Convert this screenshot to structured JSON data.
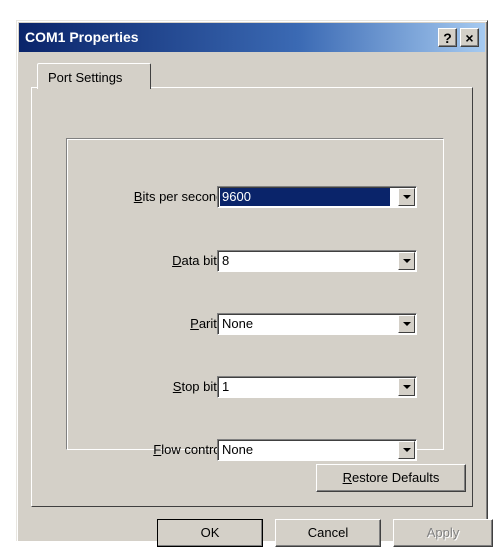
{
  "window": {
    "title": "COM1 Properties",
    "help_label": "?",
    "close_label": "×"
  },
  "tabs": [
    {
      "label": "Port Settings",
      "active": true
    }
  ],
  "fields": {
    "bits_per_second": {
      "label_accel": "B",
      "label_rest": "its per second:",
      "value": "9600"
    },
    "data_bits": {
      "label_pre": "",
      "label_accel": "D",
      "label_rest": "ata bits:",
      "value": "8"
    },
    "parity": {
      "label_accel": "P",
      "label_rest": "arity:",
      "value": "None"
    },
    "stop_bits": {
      "label_accel": "S",
      "label_rest": "top bits:",
      "value": "1"
    },
    "flow_control": {
      "label_accel": "F",
      "label_rest": "low control:",
      "value": "None"
    }
  },
  "buttons": {
    "restore_accel": "R",
    "restore_rest": "estore Defaults",
    "ok": "OK",
    "cancel": "Cancel",
    "apply": "Apply"
  },
  "colors": {
    "title_gradient_start": "#0a246a",
    "title_gradient_end": "#a6caf0",
    "dialog_face": "#d4d0c8",
    "selection": "#0a246a"
  }
}
